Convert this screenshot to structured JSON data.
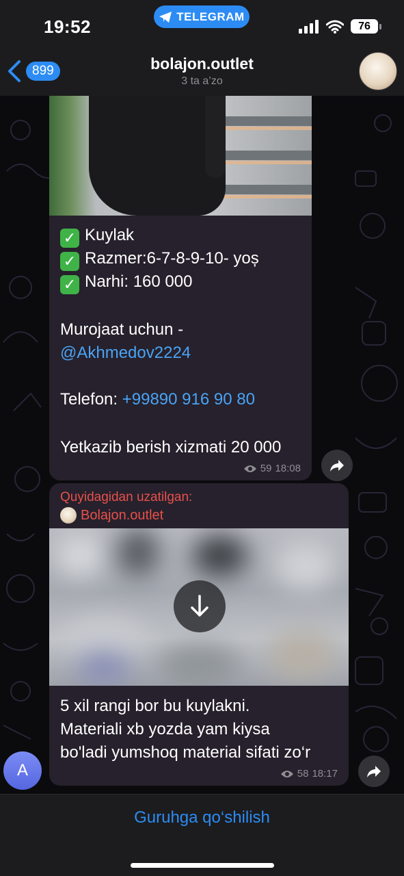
{
  "status_bar": {
    "time": "19:52",
    "app_pill": "TELEGRAM",
    "battery": "76"
  },
  "header": {
    "back_count": "899",
    "title": "bolajon.outlet",
    "subtitle": "3 ta a’zo"
  },
  "messages": [
    {
      "lines": [
        "Kuylak",
        "Razmer:6-7-8-9-10- yoș",
        "Narhi: 160 000"
      ],
      "contact_label": "Murojaat uchun -",
      "contact_handle": "@Akhmedov2224",
      "phone_label": "Telefon: ",
      "phone_number": "+99890 916 90 80",
      "delivery": "Yetkazib berish xizmati 20 000",
      "views": "59",
      "time": "18:08"
    },
    {
      "forwarded_label": "Quyidagidan uzatilgan:",
      "forwarded_from": "Bolajon.outlet",
      "text_lines": [
        "5 xil rangi bor bu kuylakni.",
        "Materiali xb yozda yam kiysa",
        "bo'ladi yumshoq material sifati zo‘r"
      ],
      "views": "58",
      "time": "18:17"
    }
  ],
  "user_avatar_letter": "A",
  "bottom": {
    "join_label": "Guruhga qo‘shilish"
  },
  "colors": {
    "accent": "#2c8cf4",
    "forward_red": "#e8504b",
    "link": "#4aa3f5",
    "check_green": "#3fb347"
  }
}
